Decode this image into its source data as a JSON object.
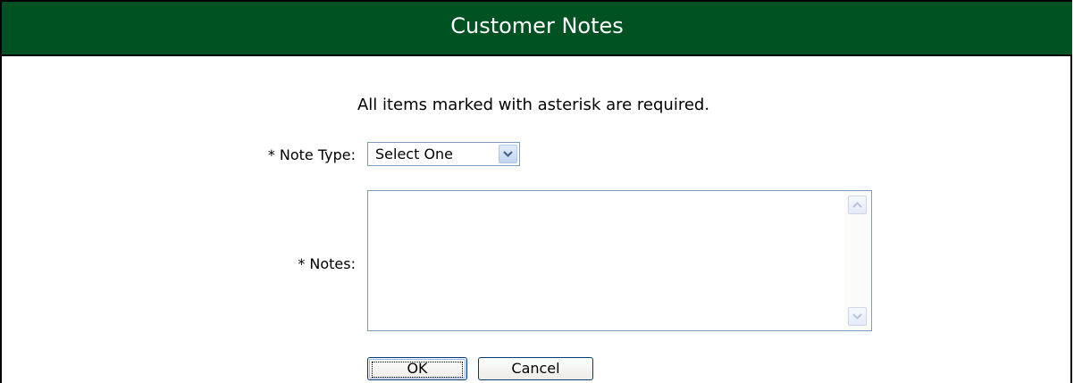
{
  "dialog": {
    "title": "Customer Notes",
    "required_note": "All items marked with asterisk are required."
  },
  "form": {
    "note_type": {
      "label": "* Note Type:",
      "selected": "Select One",
      "icon": "chevron-down-icon"
    },
    "notes": {
      "label": "* Notes:",
      "value": "",
      "scroll_up_icon": "chevron-up-icon",
      "scroll_down_icon": "chevron-down-icon"
    }
  },
  "buttons": {
    "ok_label": "OK",
    "cancel_label": "Cancel"
  },
  "colors": {
    "title_bar": "#005222",
    "title_text": "#ffffff",
    "input_border": "#7f9db9",
    "button_border": "#003c74"
  }
}
